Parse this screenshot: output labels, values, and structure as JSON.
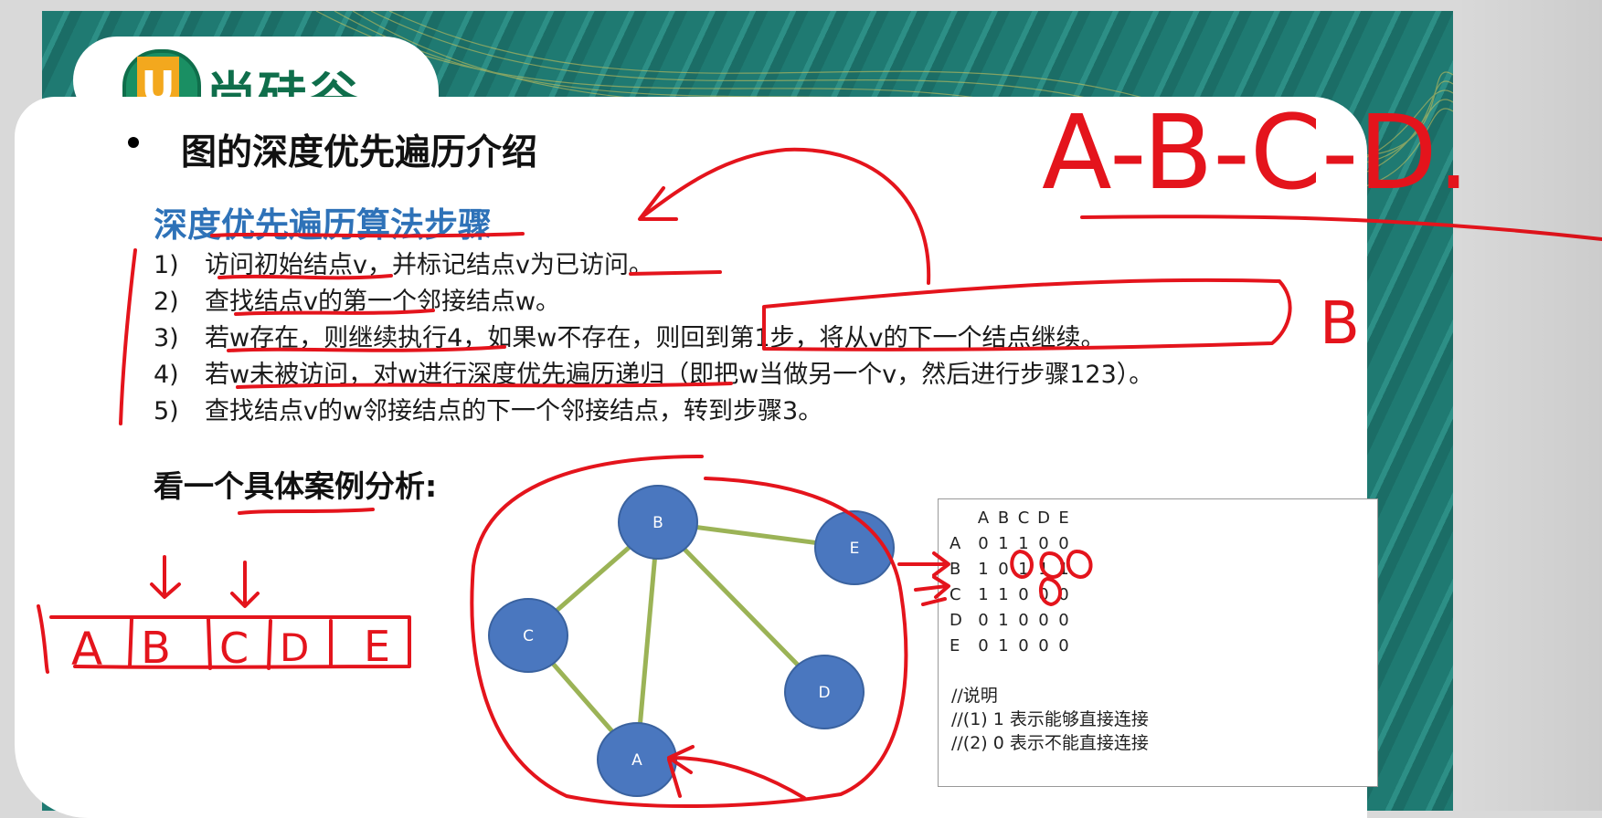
{
  "logo": {
    "letter": "U",
    "text": "尚硅谷"
  },
  "title": "图的深度优先遍历介绍",
  "subtitle": "深度优先遍历算法步骤",
  "steps": [
    {
      "num": "1)",
      "text": "访问初始结点v，并标记结点v为已访问。"
    },
    {
      "num": "2)",
      "text": "查找结点v的第一个邻接结点w。"
    },
    {
      "num": "3)",
      "text": "若w存在，则继续执行4，如果w不存在，则回到第1步，将从v的下一个结点继续。"
    },
    {
      "num": "4)",
      "text": "若w未被访问，对w进行深度优先遍历递归（即把w当做另一个v，然后进行步骤123）。"
    },
    {
      "num": "5)",
      "text": "查找结点v的w邻接结点的下一个邻接结点，转到步骤3。"
    }
  ],
  "case_title": "看一个具体案例分析:",
  "graph": {
    "nodes": [
      "B",
      "E",
      "C",
      "D",
      "A"
    ],
    "edges": [
      [
        "B",
        "E"
      ],
      [
        "B",
        "C"
      ],
      [
        "B",
        "A"
      ],
      [
        "B",
        "D"
      ],
      [
        "C",
        "A"
      ]
    ],
    "node_color": "#4a77bf",
    "edge_color": "#9bb356"
  },
  "matrix": {
    "headers": [
      "A",
      "B",
      "C",
      "D",
      "E"
    ],
    "rows": [
      {
        "label": "A",
        "values": [
          "0",
          "1",
          "1",
          "0",
          "0"
        ]
      },
      {
        "label": "B",
        "values": [
          "1",
          "0",
          "1",
          "1",
          "1"
        ]
      },
      {
        "label": "C",
        "values": [
          "1",
          "1",
          "0",
          "0",
          "0"
        ]
      },
      {
        "label": "D",
        "values": [
          "0",
          "1",
          "0",
          "0",
          "0"
        ]
      },
      {
        "label": "E",
        "values": [
          "0",
          "1",
          "0",
          "0",
          "0"
        ]
      }
    ]
  },
  "notes": [
    "//说明",
    "//(1) 1 表示能够直接连接",
    "//(2) 0 表示不能直接连接"
  ],
  "handwriting": {
    "traversal_top": "A-B-C-D.",
    "side_letter": "B",
    "array_cells": [
      "A",
      "B",
      "C",
      "D",
      "E"
    ],
    "ink_color": "#e4141c"
  }
}
